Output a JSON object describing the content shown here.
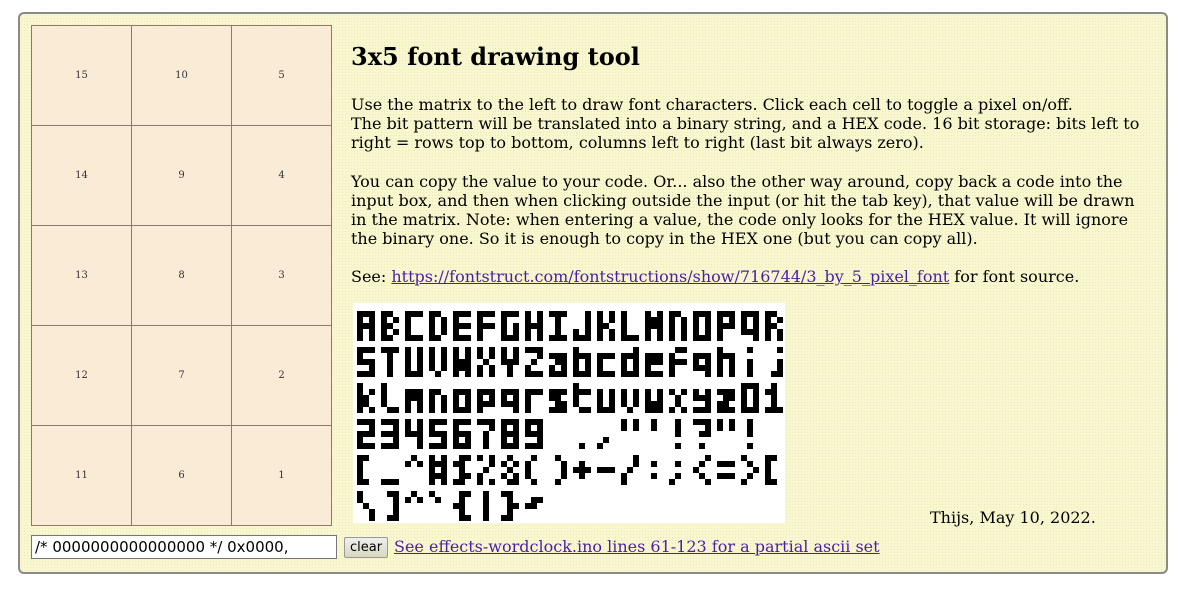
{
  "matrix": {
    "cells": [
      "15",
      "10",
      "5",
      "14",
      "9",
      "4",
      "13",
      "8",
      "3",
      "12",
      "7",
      "2",
      "11",
      "6",
      "1"
    ]
  },
  "header": {
    "title": "3x5 font drawing tool"
  },
  "intro": {
    "line1": "Use the matrix to the left to draw font characters. Click each cell to toggle a pixel on/off.",
    "line2": "The bit pattern will be translated into a binary string, and a HEX code. 16 bit storage: bits left to right = rows top to bottom, columns left to right (last bit always zero)."
  },
  "copy_info": "You can copy the value to your code. Or... also the other way around, copy back a code into the input box, and then when clicking outside the input (or hit the tab key), that value will be drawn in the matrix. Note: when entering a value, the code only looks for the HEX value. It will ignore the binary one. So it is enough to copy in the HEX one (but you can copy all).",
  "see": {
    "prefix": "See: ",
    "link": "https://fontstruct.com/fontstructions/show/716744/3_by_5_pixel_font",
    "suffix": " for font source."
  },
  "font_image": {
    "rows": [
      "ABCDEFGHIJKLMNOPQR",
      "STUVWXYZabcdefghij",
      "klmnopqrstuvwxyz01",
      "23456789 .,\"'!?\"!",
      "[_^#$%&()+-/:;<=>[",
      "\\]^`{|}~"
    ]
  },
  "signature": "Thijs, May 10, 2022.",
  "code_input": {
    "value": "/* 0000000000000000 */ 0x0000,"
  },
  "clear_button": "clear",
  "code_link": "See effects-wordclock.ino lines 61-123 for a partial ascii set",
  "colors": {
    "panel_bg": "#f8f7cf",
    "cell_bg": "#faebd7",
    "link": "#4a1ea8"
  }
}
